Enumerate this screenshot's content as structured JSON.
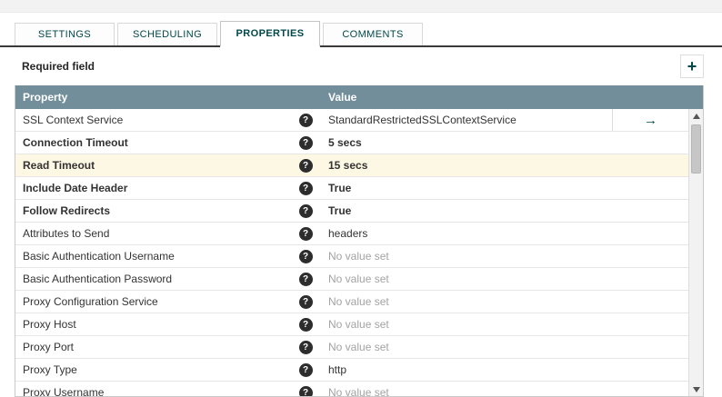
{
  "tabs": [
    {
      "label": "SETTINGS",
      "active": false
    },
    {
      "label": "SCHEDULING",
      "active": false
    },
    {
      "label": "PROPERTIES",
      "active": true
    },
    {
      "label": "COMMENTS",
      "active": false
    }
  ],
  "toolbar": {
    "required_field_label": "Required field",
    "add_button_glyph": "+"
  },
  "table": {
    "columns": [
      "Property",
      "Value"
    ],
    "help_icon_glyph": "?",
    "goto_icon_glyph": "→",
    "rows": [
      {
        "property": "SSL Context Service",
        "value": "StandardRestrictedSSLContextService",
        "required": false,
        "modified": false,
        "empty": false,
        "goto": true
      },
      {
        "property": "Connection Timeout",
        "value": "5 secs",
        "required": true,
        "modified": false,
        "empty": false,
        "goto": false
      },
      {
        "property": "Read Timeout",
        "value": "15 secs",
        "required": true,
        "modified": true,
        "empty": false,
        "goto": false
      },
      {
        "property": "Include Date Header",
        "value": "True",
        "required": true,
        "modified": false,
        "empty": false,
        "goto": false
      },
      {
        "property": "Follow Redirects",
        "value": "True",
        "required": true,
        "modified": false,
        "empty": false,
        "goto": false
      },
      {
        "property": "Attributes to Send",
        "value": "headers",
        "required": false,
        "modified": false,
        "empty": false,
        "goto": false
      },
      {
        "property": "Basic Authentication Username",
        "value": "No value set",
        "required": false,
        "modified": false,
        "empty": true,
        "goto": false
      },
      {
        "property": "Basic Authentication Password",
        "value": "No value set",
        "required": false,
        "modified": false,
        "empty": true,
        "goto": false
      },
      {
        "property": "Proxy Configuration Service",
        "value": "No value set",
        "required": false,
        "modified": false,
        "empty": true,
        "goto": false
      },
      {
        "property": "Proxy Host",
        "value": "No value set",
        "required": false,
        "modified": false,
        "empty": true,
        "goto": false
      },
      {
        "property": "Proxy Port",
        "value": "No value set",
        "required": false,
        "modified": false,
        "empty": true,
        "goto": false
      },
      {
        "property": "Proxy Type",
        "value": "http",
        "required": false,
        "modified": false,
        "empty": false,
        "goto": false
      },
      {
        "property": "Proxy Username",
        "value": "No value set",
        "required": false,
        "modified": false,
        "empty": true,
        "goto": false
      }
    ]
  },
  "colors": {
    "table_header_bg": "#728E9B",
    "accent_teal": "#004849",
    "modified_row_highlight": "#FDF8E3",
    "empty_value_text": "#A3A3A3"
  }
}
